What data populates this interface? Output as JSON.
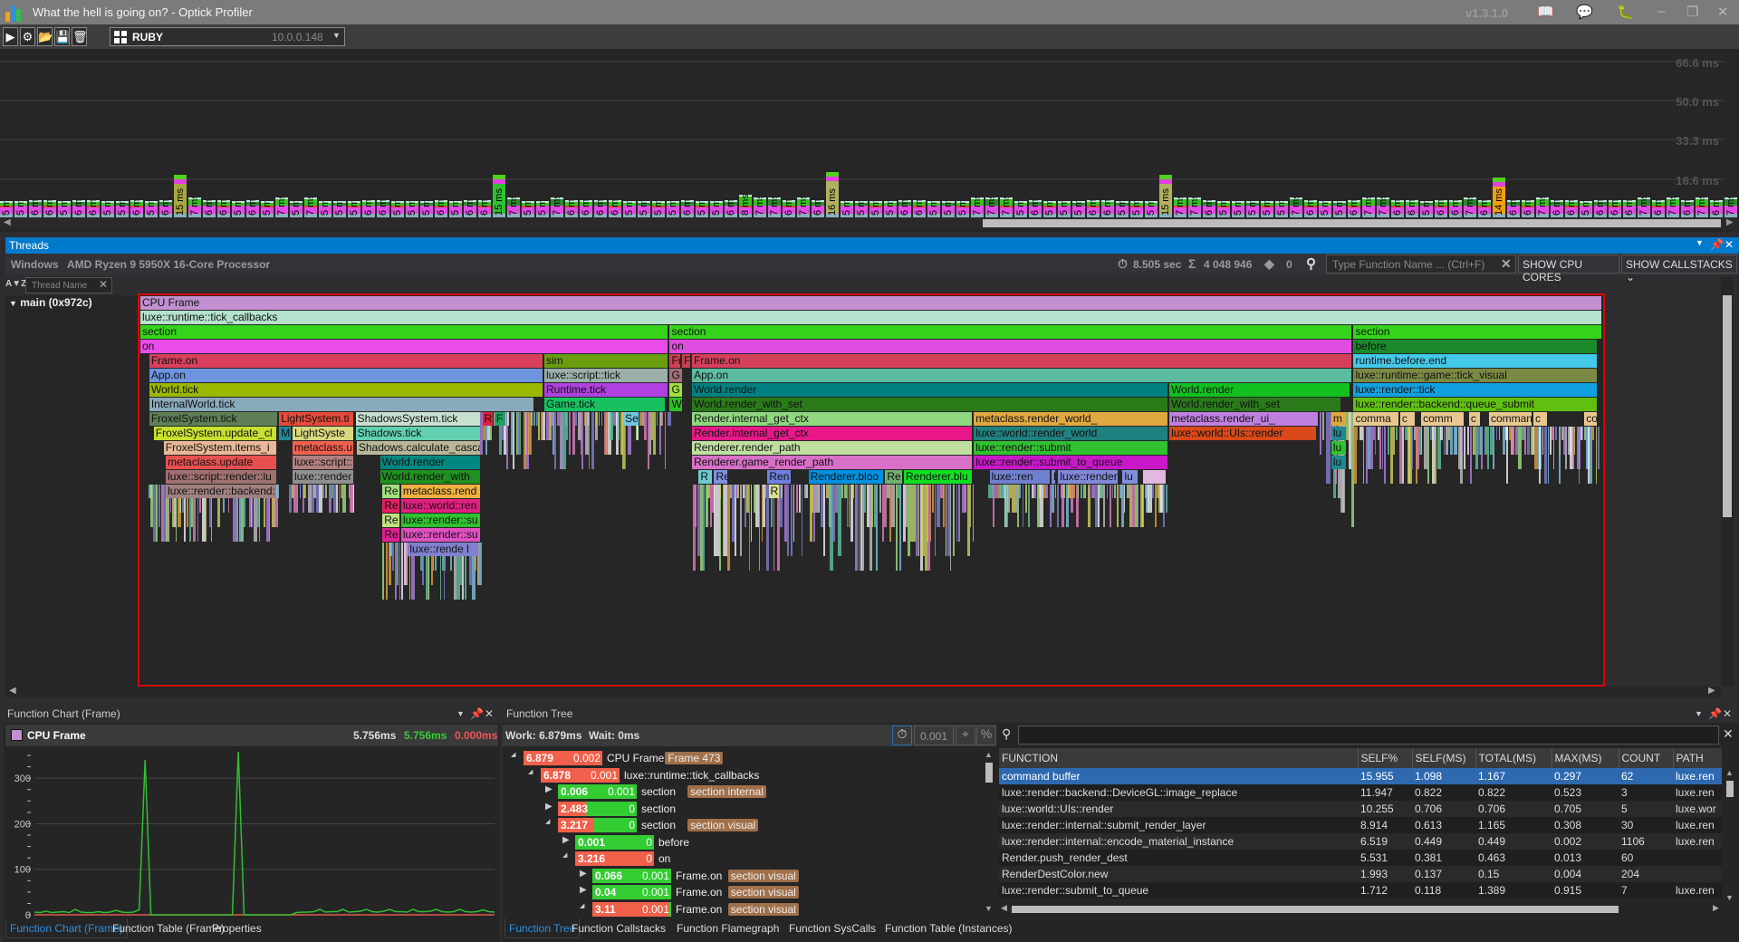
{
  "window": {
    "title": "What the hell is going on? - Optick Profiler",
    "version": "v1.3.1.0"
  },
  "toolbar": {
    "platform": "RUBY",
    "address": "10.0.0.148"
  },
  "timeline": {
    "grid_labels": [
      "66.6 ms",
      "50.0 ms",
      "33.3 ms",
      "16.6 ms"
    ],
    "grid_values": [
      66.6,
      50.0,
      33.3,
      16.6
    ],
    "unit": "ms",
    "frames": [
      5,
      5,
      6,
      6,
      5,
      6,
      6,
      5,
      5,
      6,
      5,
      6,
      15,
      7,
      6,
      6,
      5,
      6,
      5,
      7,
      5,
      7,
      5,
      5,
      5,
      6,
      6,
      5,
      5,
      5,
      6,
      5,
      6,
      6,
      15,
      7,
      5,
      5,
      7,
      6,
      6,
      6,
      6,
      5,
      5,
      5,
      5,
      6,
      5,
      5,
      6,
      8,
      7,
      7,
      6,
      7,
      6,
      16,
      5,
      5,
      5,
      5,
      6,
      6,
      5,
      5,
      5,
      7,
      7,
      7,
      5,
      6,
      5,
      5,
      5,
      6,
      6,
      5,
      5,
      5,
      15,
      7,
      7,
      6,
      5,
      5,
      5,
      5,
      5,
      7,
      6,
      5,
      5,
      6,
      7,
      7,
      6,
      6,
      5,
      6,
      6,
      7,
      6,
      14,
      6,
      6,
      7,
      6,
      6,
      5,
      6,
      6,
      6,
      7,
      6,
      7,
      6,
      7,
      6,
      7
    ],
    "spike_colors": {
      "12": "#a8a840",
      "34": "#30c030",
      "57": "#b0b060",
      "80": "#b0b060",
      "103": "#f0a010"
    }
  },
  "threads": {
    "title": "Threads",
    "os": "Windows",
    "cpu": "AMD Ryzen 9 5950X 16-Core Processor",
    "duration": "8.505 sec",
    "events": "4 048 946",
    "tags": "0",
    "search_placeholder": "Type Function Name ... (Ctrl+F)",
    "show_cpu_cores": "SHOW CPU CORES",
    "show_callstacks": "SHOW CALLSTACKS",
    "thread_name_placeholder": "Thread Name",
    "thread": "main (0x972c)"
  },
  "flame": {
    "range_ms": [
      0,
      6.879
    ],
    "blocks": [
      [
        0,
        0,
        6.879,
        "CPU Frame",
        "#c090d0"
      ],
      [
        1,
        0,
        6.879,
        "luxe::runtime::tick_callbacks",
        "#b4e2cc"
      ],
      [
        2,
        0,
        2.483,
        "section",
        "#35d41a"
      ],
      [
        2,
        2.491,
        5.703,
        "section",
        "#35d41a"
      ],
      [
        2,
        5.709,
        6.879,
        "section",
        "#35d41a"
      ],
      [
        3,
        0,
        2.486,
        "on",
        "#ea4ce8"
      ],
      [
        3,
        2.491,
        5.703,
        "on",
        "#e04ce0"
      ],
      [
        3,
        5.709,
        6.858,
        "before",
        "#1a8a2a"
      ],
      [
        4,
        0.042,
        1.896,
        "Frame.on",
        "#d8405c"
      ],
      [
        4,
        1.901,
        2.486,
        "sim",
        "#6a9e10"
      ],
      [
        4,
        2.491,
        2.544,
        "Fr",
        "#d04050"
      ],
      [
        4,
        2.549,
        2.591,
        "F",
        "#c84050"
      ],
      [
        4,
        2.596,
        5.703,
        "Frame.on",
        "#d4405a"
      ],
      [
        4,
        5.709,
        6.858,
        "runtime.before.end",
        "#44c8e8"
      ],
      [
        5,
        0.042,
        1.896,
        "App.on",
        "#6e94e0"
      ],
      [
        5,
        1.901,
        2.486,
        "luxe::script::tick",
        "#9ab0a8"
      ],
      [
        5,
        2.491,
        2.554,
        "G",
        "#a07078"
      ],
      [
        5,
        2.596,
        5.703,
        "App.on",
        "#5cbca0"
      ],
      [
        5,
        5.709,
        6.858,
        "luxe::runtime::game::tick_visual",
        "#7a8a44"
      ],
      [
        6,
        0.042,
        1.896,
        "World.tick",
        "#9ab800"
      ],
      [
        6,
        1.901,
        2.486,
        "Runtime.tick",
        "#b040e0"
      ],
      [
        6,
        2.491,
        2.554,
        "G",
        "#a0e040"
      ],
      [
        6,
        2.596,
        4.837,
        "World.render",
        "#008080"
      ],
      [
        6,
        4.842,
        5.693,
        "World.render",
        "#12c020"
      ],
      [
        6,
        5.709,
        6.858,
        "luxe::render::tick",
        "#10a0e0"
      ],
      [
        7,
        0.042,
        1.854,
        "InternalWorld.tick",
        "#88aabb"
      ],
      [
        7,
        1.901,
        2.47,
        "Game.tick",
        "#18c060"
      ],
      [
        7,
        2.491,
        2.554,
        "W",
        "#30c020"
      ],
      [
        7,
        2.596,
        4.837,
        "World.render_with_set",
        "#2a7a1a"
      ],
      [
        7,
        4.842,
        5.651,
        "World.render_with_set",
        "#2a7a1a"
      ],
      [
        7,
        5.709,
        6.858,
        "luxe::render::backend::queue_submit",
        "#60c010"
      ],
      [
        8,
        0.042,
        0.648,
        "FroxelSystem.tick",
        "#5f7f56"
      ],
      [
        8,
        0.653,
        1.008,
        "LightSystem.ti",
        "#e84a3a"
      ],
      [
        8,
        1.013,
        1.603,
        "ShadowsSystem.tick",
        "#c8e0d0"
      ],
      [
        8,
        1.609,
        1.661,
        "R",
        "#e02040"
      ],
      [
        8,
        1.666,
        1.724,
        "F",
        "#20a060"
      ],
      [
        8,
        2.272,
        2.35,
        "Se",
        "#70c8e0"
      ],
      [
        8,
        2.596,
        3.917,
        "Render.internal_get_ctx",
        "#90d880"
      ],
      [
        8,
        3.922,
        4.837,
        "metaclass.render_world_",
        "#e0a840"
      ],
      [
        8,
        4.842,
        5.547,
        "metaclass.render_ui_",
        "#c080e0"
      ],
      [
        8,
        5.604,
        5.677,
        "m",
        "#e0a840"
      ],
      [
        8,
        5.709,
        5.923,
        "comma",
        "#e8c890"
      ],
      [
        8,
        5.928,
        6.001,
        "c",
        "#e8c890"
      ],
      [
        8,
        6.027,
        6.231,
        "comm",
        "#e8c890"
      ],
      [
        8,
        6.252,
        6.309,
        "c",
        "#e8c890"
      ],
      [
        8,
        6.346,
        6.55,
        "command b",
        "#e8c890"
      ],
      [
        8,
        6.555,
        6.623,
        "c",
        "#e8c890"
      ],
      [
        8,
        6.795,
        6.858,
        "co",
        "#e8c890"
      ],
      [
        9,
        0.063,
        0.642,
        "FroxelSystem.update_cl",
        "#c8e030"
      ],
      [
        9,
        0.653,
        0.71,
        "M",
        "#208898"
      ],
      [
        9,
        0.716,
        1.008,
        "LightSyste",
        "#d8d880"
      ],
      [
        9,
        1.013,
        1.603,
        "Shadows.tick",
        "#60d0b0"
      ],
      [
        9,
        2.596,
        3.917,
        "Render.internal_get_ctx",
        "#e81888"
      ],
      [
        9,
        3.922,
        4.837,
        "luxe::world::render_world",
        "#208080"
      ],
      [
        9,
        4.842,
        5.536,
        "luxe::world::UIs::render",
        "#d84818"
      ],
      [
        9,
        5.604,
        5.677,
        "lu",
        "#208890"
      ],
      [
        10,
        0.11,
        0.642,
        "FroxelSystem.items_i",
        "#e8b898"
      ],
      [
        10,
        0.716,
        1.008,
        "metaclass.u",
        "#f06050"
      ],
      [
        10,
        1.018,
        1.603,
        "Shadows.calculate_casca",
        "#b8b898"
      ],
      [
        10,
        2.596,
        3.917,
        "Renderer.render_path",
        "#c0e0a0"
      ],
      [
        10,
        3.922,
        4.837,
        "luxe::render::submit",
        "#30c030"
      ],
      [
        10,
        5.604,
        5.677,
        "lu",
        "#30c030"
      ],
      [
        11,
        0.12,
        0.642,
        "metaclass.update",
        "#e85050"
      ],
      [
        11,
        0.716,
        1.008,
        "luxe::script::",
        "#b08080"
      ],
      [
        11,
        1.128,
        1.603,
        "World.render",
        "#008880"
      ],
      [
        11,
        2.596,
        3.917,
        "Renderer.game_render_path",
        "#d870c8"
      ],
      [
        11,
        3.922,
        4.837,
        "luxe::render::submit_to_queue",
        "#c818c8"
      ],
      [
        11,
        5.604,
        5.677,
        "lu",
        "#208890"
      ],
      [
        12,
        0.12,
        0.642,
        "luxe::script::render::lu",
        "#a07070"
      ],
      [
        12,
        0.716,
        1.008,
        "luxe::render",
        "#909090"
      ],
      [
        12,
        1.128,
        1.603,
        "World.render_with",
        "#209020"
      ],
      [
        12,
        2.627,
        2.695,
        "R",
        "#70c8d0"
      ],
      [
        12,
        2.7,
        2.768,
        "Re",
        "#8090e0"
      ],
      [
        12,
        2.951,
        3.066,
        "Ren",
        "#7080e0"
      ],
      [
        12,
        3.144,
        3.499,
        "Renderer.bloo",
        "#0090e0"
      ],
      [
        12,
        3.505,
        3.588,
        "Re",
        "#70b070"
      ],
      [
        12,
        3.593,
        3.917,
        "Renderer.blu",
        "#10e020"
      ],
      [
        12,
        3.996,
        4.283,
        "luxe::ren",
        "#7080d0"
      ],
      [
        12,
        4.288,
        4.309,
        "l",
        "#8088d8"
      ],
      [
        12,
        4.319,
        4.601,
        "luxe::render:",
        "#8088d8"
      ],
      [
        12,
        4.622,
        4.696,
        "lu",
        "#8090e0"
      ],
      [
        12,
        4.716,
        4.831,
        "",
        "#e0b8e0"
      ],
      [
        13,
        0.12,
        0.642,
        "luxe::render::backend:",
        "#a08080"
      ],
      [
        13,
        1.139,
        1.222,
        "Re",
        "#a0e080"
      ],
      [
        13,
        1.227,
        1.603,
        "metaclass.rend",
        "#f0b040"
      ],
      [
        13,
        2.956,
        3.008,
        "R",
        "#d8e090"
      ],
      [
        14,
        1.139,
        1.222,
        "Re",
        "#e02060"
      ],
      [
        14,
        1.227,
        1.603,
        "luxe::world::ren",
        "#e02080"
      ],
      [
        15,
        1.139,
        1.222,
        "Re",
        "#c0e080"
      ],
      [
        15,
        1.227,
        1.603,
        "luxe::render::su",
        "#30c030"
      ],
      [
        16,
        1.139,
        1.222,
        "Re",
        "#e02090"
      ],
      [
        16,
        1.227,
        1.603,
        "luxe::render::su",
        "#e050c0"
      ],
      [
        17,
        1.259,
        1.593,
        "luxe::rende  l",
        "#8080d0"
      ]
    ]
  },
  "function_chart": {
    "title": "Function Chart (Frame)",
    "legend": "CPU Frame",
    "legend_color": "#c090d0",
    "value_total": "5.756ms",
    "value_work": "5.756ms",
    "value_wait": "0.000ms",
    "chart_data": {
      "type": "line",
      "y_ticks": [
        0,
        100,
        200,
        300
      ],
      "ylim": [
        0,
        358
      ],
      "grid": true,
      "series": [
        {
          "color": "#30c030",
          "values": [
            6,
            5,
            8,
            5,
            6,
            7,
            5,
            12,
            6,
            5,
            5,
            7,
            5,
            6,
            10,
            6,
            5,
            6,
            11,
            340,
            0,
            0,
            0,
            0,
            0,
            0,
            0,
            0,
            0,
            0,
            0,
            0,
            0,
            0,
            0,
            358,
            0,
            0,
            0,
            0,
            0,
            0,
            0,
            0,
            0,
            5,
            6,
            6,
            7,
            12,
            6,
            7,
            7,
            12,
            6,
            7,
            8,
            12,
            7,
            6,
            8,
            12,
            7,
            7,
            6,
            12,
            7,
            7,
            8,
            12,
            7,
            6,
            7,
            12,
            7,
            6,
            7,
            11,
            7,
            6
          ]
        },
        {
          "color": "#e05a4a",
          "values": [
            0,
            0,
            0,
            0,
            0,
            0,
            0,
            0,
            0,
            0,
            0,
            0,
            0,
            0,
            0,
            0,
            0,
            0,
            0,
            0,
            0,
            0,
            0,
            0,
            0,
            0,
            0,
            0,
            0,
            0,
            0,
            0,
            0,
            0,
            0,
            0,
            0,
            0,
            0,
            0,
            0,
            0,
            0,
            0,
            0,
            0,
            0,
            0,
            0,
            0,
            0,
            0,
            0,
            0,
            0,
            0,
            0,
            0,
            0,
            0,
            0,
            0,
            0,
            0,
            0,
            0,
            0,
            0,
            0,
            0,
            0,
            0,
            0,
            0,
            0,
            0,
            0,
            0,
            0,
            0
          ]
        }
      ]
    },
    "tabs": [
      "Function Chart (Frame)",
      "Function Table (Frame)",
      "Properties"
    ]
  },
  "function_tree": {
    "title": "Function Tree",
    "work": "Work: 6.879ms",
    "wait": "Wait: 0ms",
    "threshold": "0.001",
    "rows": [
      {
        "level": 0,
        "expanded": true,
        "total": "6.879",
        "self": "0.002",
        "name": "CPU Frame",
        "tag": "Frame 473",
        "fill": 1
      },
      {
        "level": 1,
        "expanded": true,
        "total": "6.878",
        "self": "0.001",
        "name": "luxe::runtime::tick_callbacks",
        "tag": "",
        "fill": 1
      },
      {
        "level": 2,
        "expanded": false,
        "total": "0.006",
        "self": "0.001",
        "name": "section",
        "tag": "section internal",
        "fill": 0
      },
      {
        "level": 2,
        "expanded": false,
        "total": "2.483",
        "self": "0",
        "name": "section",
        "tag": "",
        "fill": 0.36
      },
      {
        "level": 2,
        "expanded": true,
        "total": "3.217",
        "self": "0",
        "name": "section",
        "tag": "section visual",
        "fill": 0.46
      },
      {
        "level": 3,
        "expanded": false,
        "total": "0.001",
        "self": "0",
        "name": "before",
        "tag": "",
        "fill": 0
      },
      {
        "level": 3,
        "expanded": true,
        "total": "3.216",
        "self": "0",
        "name": "on",
        "tag": "",
        "fill": 1
      },
      {
        "level": 4,
        "expanded": false,
        "total": "0.066",
        "self": "0.001",
        "name": "Frame.on",
        "tag": "section visual",
        "fill": 0
      },
      {
        "level": 4,
        "expanded": false,
        "total": "0.04",
        "self": "0.001",
        "name": "Frame.on",
        "tag": "section visual",
        "fill": 0
      },
      {
        "level": 4,
        "expanded": true,
        "total": "3.11",
        "self": "0.001",
        "name": "Frame.on",
        "tag": "section visual",
        "fill": 0.97
      }
    ],
    "tabs": [
      "Function Tree",
      "Function Callstacks",
      "Function Flamegraph",
      "Function SysCalls",
      "Function Table (Instances)"
    ]
  },
  "function_table": {
    "columns": [
      "FUNCTION",
      "SELF%",
      "SELF(MS)",
      "TOTAL(MS)",
      "MAX(MS)",
      "COUNT",
      "PATH"
    ],
    "rows": [
      [
        "command buffer",
        "15.955",
        "1.098",
        "1.167",
        "0.297",
        "62",
        "luxe.ren"
      ],
      [
        "luxe::render::backend::DeviceGL::image_replace",
        "11.947",
        "0.822",
        "0.822",
        "0.523",
        "3",
        "luxe.ren"
      ],
      [
        "luxe::world::UIs::render",
        "10.255",
        "0.706",
        "0.706",
        "0.705",
        "5",
        "luxe.wor"
      ],
      [
        "luxe::render::internal::submit_render_layer",
        "8.914",
        "0.613",
        "1.165",
        "0.308",
        "30",
        "luxe.ren"
      ],
      [
        "luxe::render::internal::encode_material_instance",
        "6.519",
        "0.449",
        "0.449",
        "0.002",
        "1106",
        "luxe.ren"
      ],
      [
        "Render.push_render_dest",
        "5.531",
        "0.381",
        "0.463",
        "0.013",
        "60",
        ""
      ],
      [
        "RenderDestColor.new",
        "1.993",
        "0.137",
        "0.15",
        "0.004",
        "204",
        ""
      ],
      [
        "luxe::render::submit_to_queue",
        "1.712",
        "0.118",
        "1.389",
        "0.915",
        "7",
        "luxe.ren"
      ]
    ],
    "selected_row": 0
  }
}
